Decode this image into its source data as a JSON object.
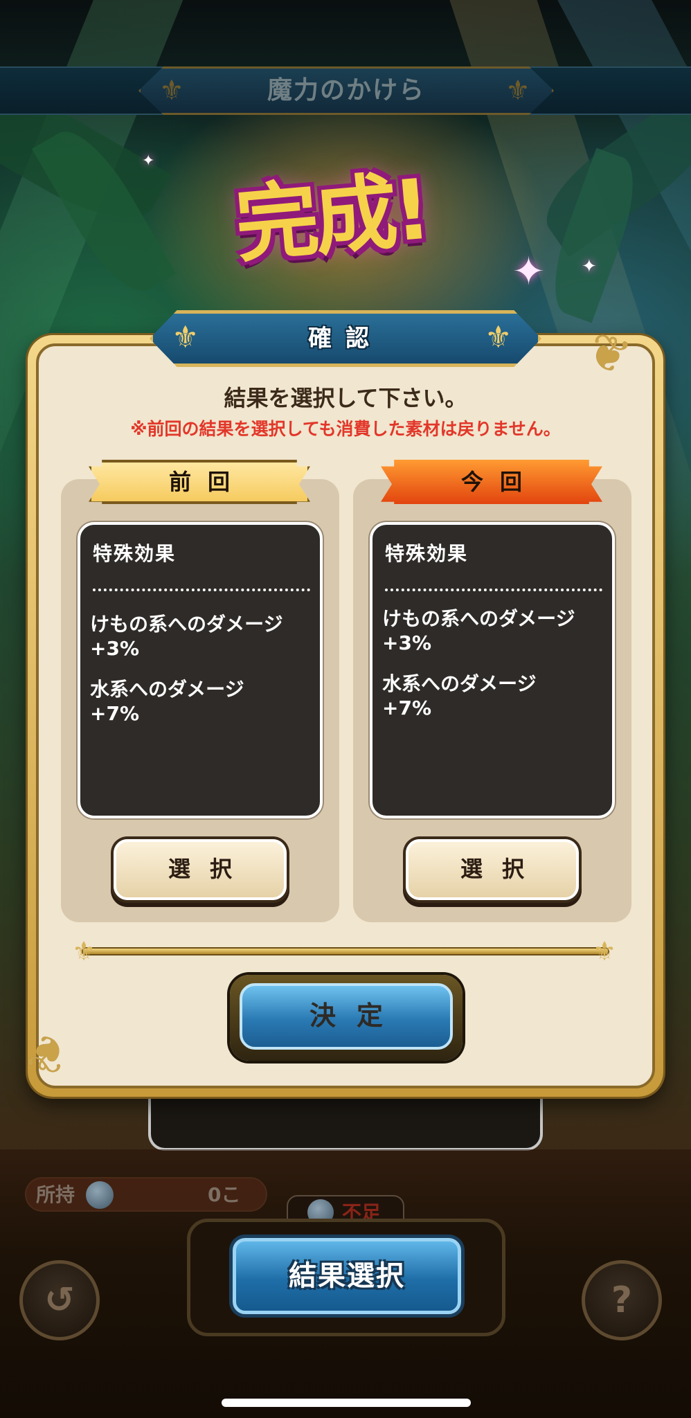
{
  "header": {
    "title": "魔力のかけら"
  },
  "banner": {
    "complete": "完成!"
  },
  "dialog": {
    "title": "確認",
    "instruction": "結果を選択して下さい。",
    "warning": "※前回の結果を選択しても消費した素材は戻りません。",
    "previous": {
      "label": "前回",
      "heading": "特殊効果",
      "effects": [
        {
          "name": "けもの系へのダメージ",
          "value": "+3%"
        },
        {
          "name": "水系へのダメージ",
          "value": "+7%"
        }
      ],
      "select_label": "選択"
    },
    "current": {
      "label": "今回",
      "heading": "特殊効果",
      "effects": [
        {
          "name": "けもの系へのダメージ",
          "value": "+3%"
        },
        {
          "name": "水系へのダメージ",
          "value": "+7%"
        }
      ],
      "select_label": "選択"
    },
    "confirm_label": "決定"
  },
  "footer": {
    "owned_label": "所持",
    "owned_count": "0こ",
    "shortage_label": "不足",
    "result_select_label": "結果選択",
    "back_icon": "back-arrow-icon",
    "help_icon": "question-icon"
  },
  "colors": {
    "accent_gold": "#d8b45a",
    "dialog_bg": "#f1e6cf",
    "warning_red": "#e2372a",
    "button_blue": "#2a7ab4",
    "ribbon_orange": "#e2440e",
    "ribbon_yellow": "#f5c95a"
  }
}
